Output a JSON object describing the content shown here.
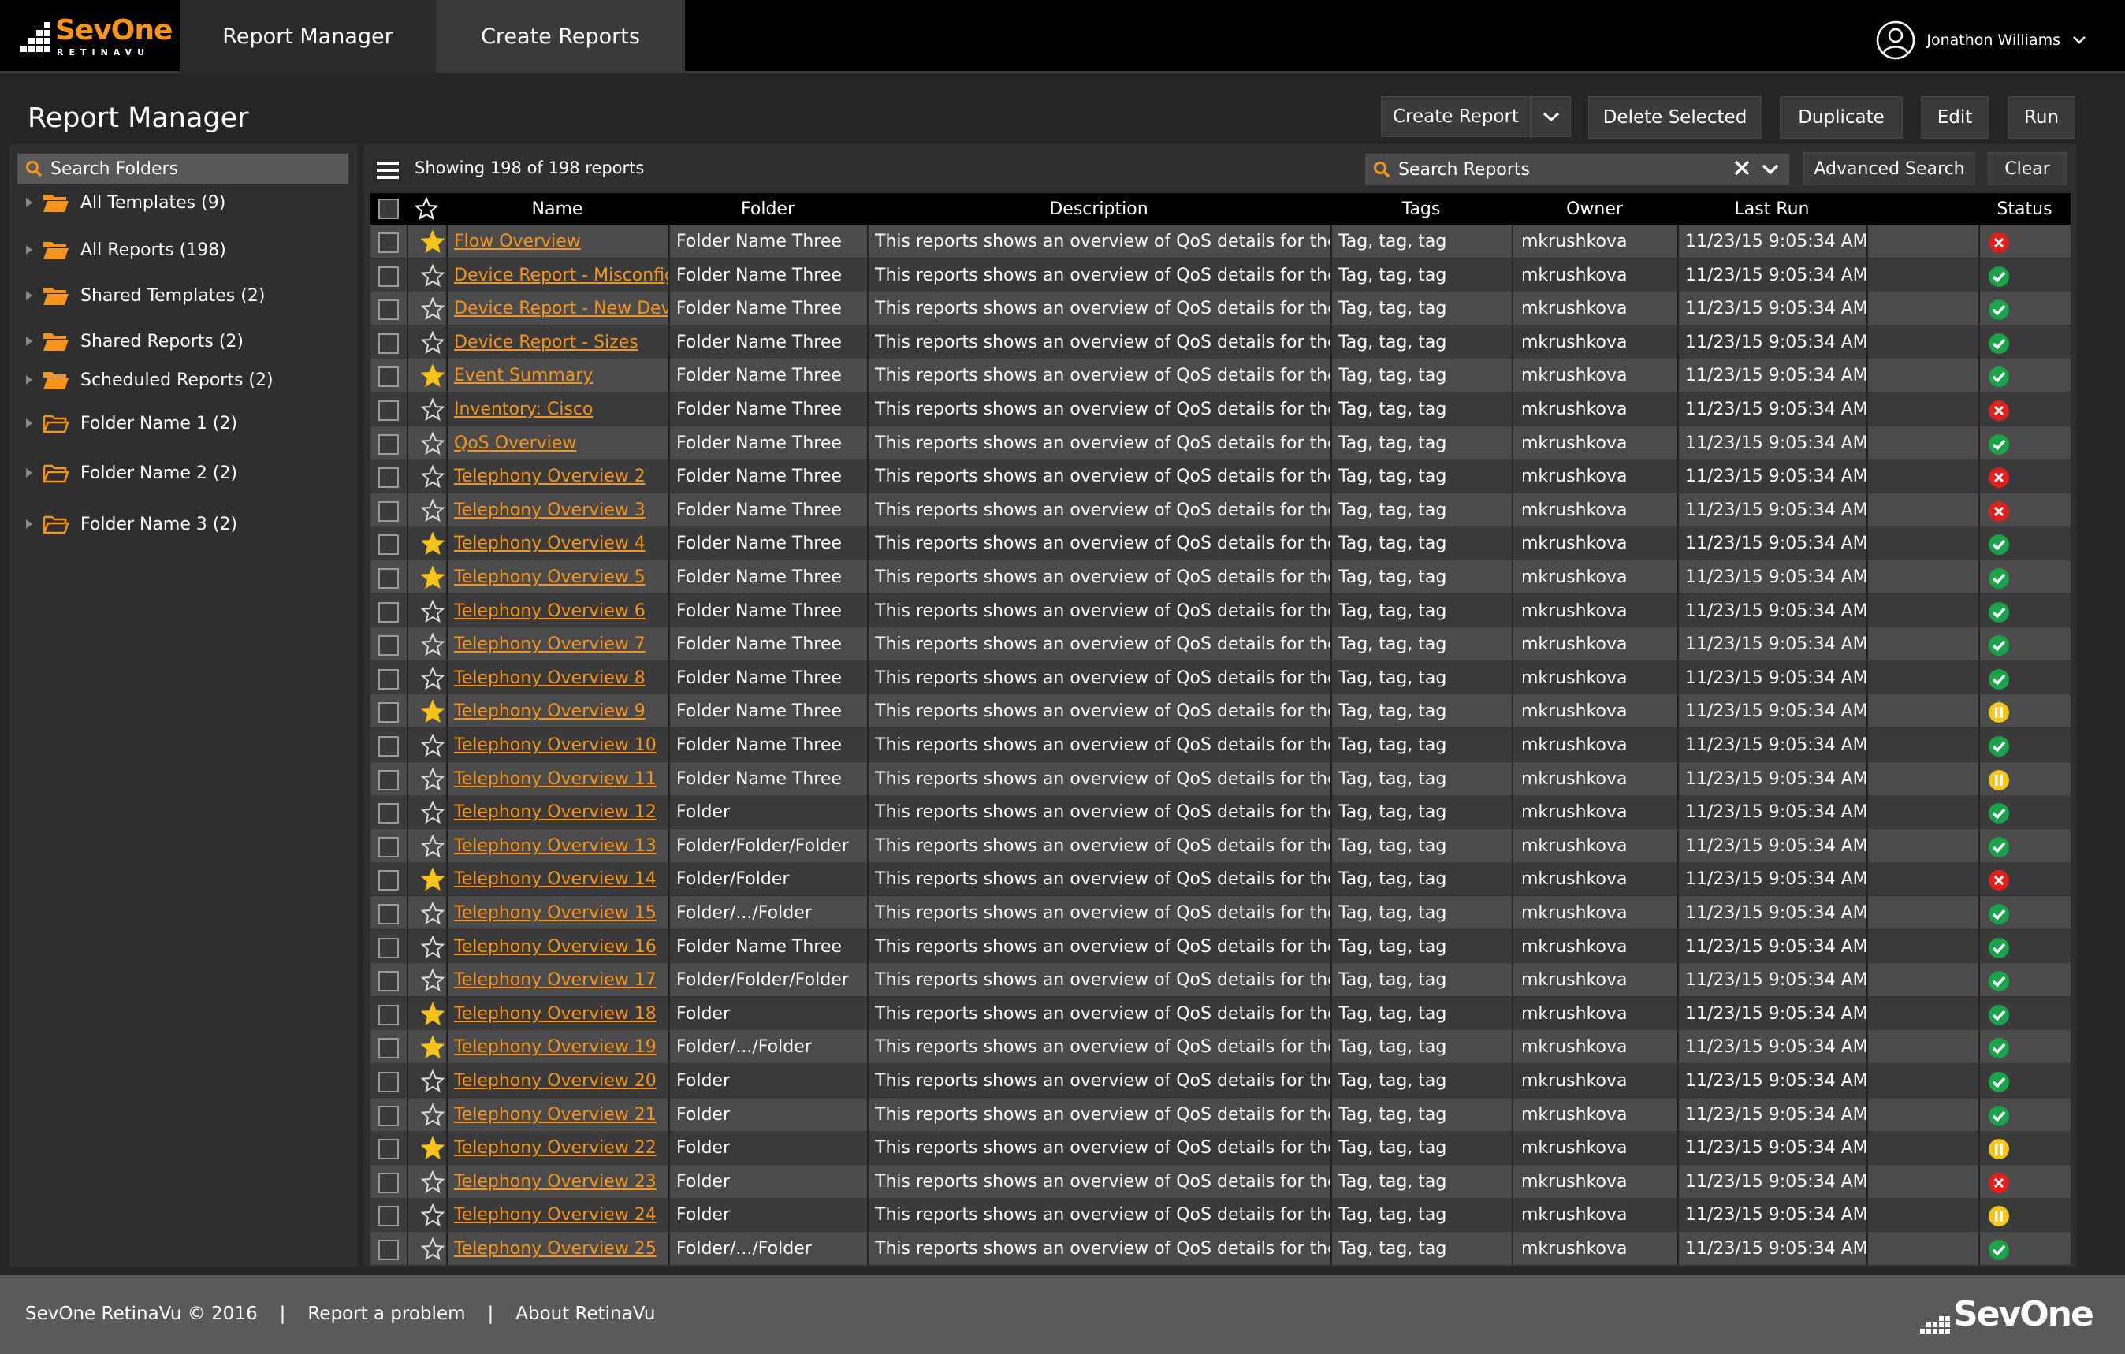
{
  "app": {
    "logo_name": "SevOne",
    "logo_sub": "RETINAVU"
  },
  "nav": {
    "tabs": [
      {
        "label": "Report Manager"
      },
      {
        "label": "Create Reports"
      }
    ]
  },
  "user": {
    "name": "Jonathon Williams"
  },
  "page": {
    "title": "Report Manager"
  },
  "actions": {
    "create": "Create Report",
    "delete": "Delete Selected",
    "duplicate": "Duplicate",
    "edit": "Edit",
    "run": "Run"
  },
  "sidebar": {
    "search_placeholder": "Search Folders",
    "items": [
      {
        "label": "All Templates (9)",
        "type": "filled"
      },
      {
        "label": "All Reports (198)",
        "type": "filled"
      },
      {
        "label": "Shared Templates (2)",
        "type": "filled"
      },
      {
        "label": "Shared Reports (2)",
        "type": "filled"
      },
      {
        "label": "Scheduled Reports (2)",
        "type": "filled"
      },
      {
        "label": "Folder Name 1 (2)",
        "type": "outline"
      },
      {
        "label": "Folder Name 2 (2)",
        "type": "outline"
      },
      {
        "label": "Folder Name 3 (2)",
        "type": "outline"
      }
    ]
  },
  "toolbar": {
    "count": "Showing 198 of 198 reports",
    "search_placeholder": "Search Reports",
    "advanced": "Advanced Search",
    "clear": "Clear"
  },
  "table": {
    "columns": [
      "Name",
      "Folder",
      "Description",
      "Tags",
      "Owner",
      "Last Run",
      "Status"
    ],
    "rows": [
      {
        "name": "Flow Overview",
        "folder": "Folder Name Three",
        "desc": "This reports shows an overview of QoS details for the...",
        "tags": "Tag, tag, tag",
        "owner": "mkrushkova",
        "last_run": "11/23/15 9:05:34 AM",
        "status": "error",
        "starred": true
      },
      {
        "name": "Device Report - Misconfiguration",
        "folder": "Folder Name Three",
        "desc": "This reports shows an overview of QoS details for the...",
        "tags": "Tag, tag, tag",
        "owner": "mkrushkova",
        "last_run": "11/23/15 9:05:34 AM",
        "status": "ok",
        "starred": false
      },
      {
        "name": "Device Report - New Devices",
        "folder": "Folder Name Three",
        "desc": "This reports shows an overview of QoS details for the...",
        "tags": "Tag, tag, tag",
        "owner": "mkrushkova",
        "last_run": "11/23/15 9:05:34 AM",
        "status": "ok",
        "starred": false
      },
      {
        "name": "Device Report - Sizes",
        "folder": "Folder Name Three",
        "desc": "This reports shows an overview of QoS details for the...",
        "tags": "Tag, tag, tag",
        "owner": "mkrushkova",
        "last_run": "11/23/15 9:05:34 AM",
        "status": "ok",
        "starred": false
      },
      {
        "name": "Event Summary",
        "folder": "Folder Name Three",
        "desc": "This reports shows an overview of QoS details for the...",
        "tags": "Tag, tag, tag",
        "owner": "mkrushkova",
        "last_run": "11/23/15 9:05:34 AM",
        "status": "ok",
        "starred": true
      },
      {
        "name": "Inventory: Cisco",
        "folder": "Folder Name Three",
        "desc": "This reports shows an overview of QoS details for the...",
        "tags": "Tag, tag, tag",
        "owner": "mkrushkova",
        "last_run": "11/23/15 9:05:34 AM",
        "status": "error",
        "starred": false
      },
      {
        "name": "QoS Overview",
        "folder": "Folder Name Three",
        "desc": "This reports shows an overview of QoS details for the...",
        "tags": "Tag, tag, tag",
        "owner": "mkrushkova",
        "last_run": "11/23/15 9:05:34 AM",
        "status": "ok",
        "starred": false
      },
      {
        "name": "Telephony Overview 2",
        "folder": "Folder Name Three",
        "desc": "This reports shows an overview of QoS details for the...",
        "tags": "Tag, tag, tag",
        "owner": "mkrushkova",
        "last_run": "11/23/15 9:05:34 AM",
        "status": "error",
        "starred": false
      },
      {
        "name": "Telephony Overview 3",
        "folder": "Folder Name Three",
        "desc": "This reports shows an overview of QoS details for the...",
        "tags": "Tag, tag, tag",
        "owner": "mkrushkova",
        "last_run": "11/23/15 9:05:34 AM",
        "status": "error",
        "starred": false
      },
      {
        "name": "Telephony Overview 4",
        "folder": "Folder Name Three",
        "desc": "This reports shows an overview of QoS details for the...",
        "tags": "Tag, tag, tag",
        "owner": "mkrushkova",
        "last_run": "11/23/15 9:05:34 AM",
        "status": "ok",
        "starred": true
      },
      {
        "name": "Telephony Overview 5",
        "folder": "Folder Name Three",
        "desc": "This reports shows an overview of QoS details for the...",
        "tags": "Tag, tag, tag",
        "owner": "mkrushkova",
        "last_run": "11/23/15 9:05:34 AM",
        "status": "ok",
        "starred": true
      },
      {
        "name": "Telephony Overview 6",
        "folder": "Folder Name Three",
        "desc": "This reports shows an overview of QoS details for the...",
        "tags": "Tag, tag, tag",
        "owner": "mkrushkova",
        "last_run": "11/23/15 9:05:34 AM",
        "status": "ok",
        "starred": false
      },
      {
        "name": "Telephony Overview 7",
        "folder": "Folder Name Three",
        "desc": "This reports shows an overview of QoS details for the...",
        "tags": "Tag, tag, tag",
        "owner": "mkrushkova",
        "last_run": "11/23/15 9:05:34 AM",
        "status": "ok",
        "starred": false
      },
      {
        "name": "Telephony Overview 8",
        "folder": "Folder Name Three",
        "desc": "This reports shows an overview of QoS details for the...",
        "tags": "Tag, tag, tag",
        "owner": "mkrushkova",
        "last_run": "11/23/15 9:05:34 AM",
        "status": "ok",
        "starred": false
      },
      {
        "name": "Telephony Overview 9",
        "folder": "Folder Name Three",
        "desc": "This reports shows an overview of QoS details for the...",
        "tags": "Tag, tag, tag",
        "owner": "mkrushkova",
        "last_run": "11/23/15 9:05:34 AM",
        "status": "pause",
        "starred": true
      },
      {
        "name": "Telephony Overview 10",
        "folder": "Folder Name Three",
        "desc": "This reports shows an overview of QoS details for the...",
        "tags": "Tag, tag, tag",
        "owner": "mkrushkova",
        "last_run": "11/23/15 9:05:34 AM",
        "status": "ok",
        "starred": false
      },
      {
        "name": "Telephony Overview 11",
        "folder": "Folder Name Three",
        "desc": "This reports shows an overview of QoS details for the...",
        "tags": "Tag, tag, tag",
        "owner": "mkrushkova",
        "last_run": "11/23/15 9:05:34 AM",
        "status": "pause",
        "starred": false
      },
      {
        "name": "Telephony Overview 12",
        "folder": "Folder",
        "desc": "This reports shows an overview of QoS details for the...",
        "tags": "Tag, tag, tag",
        "owner": "mkrushkova",
        "last_run": "11/23/15 9:05:34 AM",
        "status": "ok",
        "starred": false
      },
      {
        "name": "Telephony Overview 13",
        "folder": "Folder/Folder/Folder",
        "desc": "This reports shows an overview of QoS details for the...",
        "tags": "Tag, tag, tag",
        "owner": "mkrushkova",
        "last_run": "11/23/15 9:05:34 AM",
        "status": "ok",
        "starred": false
      },
      {
        "name": "Telephony Overview 14",
        "folder": "Folder/Folder",
        "desc": "This reports shows an overview of QoS details for the...",
        "tags": "Tag, tag, tag",
        "owner": "mkrushkova",
        "last_run": "11/23/15 9:05:34 AM",
        "status": "error",
        "starred": true
      },
      {
        "name": "Telephony Overview 15",
        "folder": "Folder/.../Folder",
        "desc": "This reports shows an overview of QoS details for the...",
        "tags": "Tag, tag, tag",
        "owner": "mkrushkova",
        "last_run": "11/23/15 9:05:34 AM",
        "status": "ok",
        "starred": false
      },
      {
        "name": "Telephony Overview 16",
        "folder": "Folder Name Three",
        "desc": "This reports shows an overview of QoS details for the...",
        "tags": "Tag, tag, tag",
        "owner": "mkrushkova",
        "last_run": "11/23/15 9:05:34 AM",
        "status": "ok",
        "starred": false
      },
      {
        "name": "Telephony Overview 17",
        "folder": "Folder/Folder/Folder",
        "desc": "This reports shows an overview of QoS details for the...",
        "tags": "Tag, tag, tag",
        "owner": "mkrushkova",
        "last_run": "11/23/15 9:05:34 AM",
        "status": "ok",
        "starred": false
      },
      {
        "name": "Telephony Overview 18",
        "folder": "Folder",
        "desc": "This reports shows an overview of QoS details for the...",
        "tags": "Tag, tag, tag",
        "owner": "mkrushkova",
        "last_run": "11/23/15 9:05:34 AM",
        "status": "ok",
        "starred": true
      },
      {
        "name": "Telephony Overview 19",
        "folder": "Folder/.../Folder",
        "desc": "This reports shows an overview of QoS details for the...",
        "tags": "Tag, tag, tag",
        "owner": "mkrushkova",
        "last_run": "11/23/15 9:05:34 AM",
        "status": "ok",
        "starred": true
      },
      {
        "name": "Telephony Overview 20",
        "folder": "Folder",
        "desc": "This reports shows an overview of QoS details for the...",
        "tags": "Tag, tag, tag",
        "owner": "mkrushkova",
        "last_run": "11/23/15 9:05:34 AM",
        "status": "ok",
        "starred": false
      },
      {
        "name": "Telephony Overview 21",
        "folder": "Folder",
        "desc": "This reports shows an overview of QoS details for the...",
        "tags": "Tag, tag, tag",
        "owner": "mkrushkova",
        "last_run": "11/23/15 9:05:34 AM",
        "status": "ok",
        "starred": false
      },
      {
        "name": "Telephony Overview 22",
        "folder": "Folder",
        "desc": "This reports shows an overview of QoS details for the...",
        "tags": "Tag, tag, tag",
        "owner": "mkrushkova",
        "last_run": "11/23/15 9:05:34 AM",
        "status": "pause",
        "starred": true
      },
      {
        "name": "Telephony Overview 23",
        "folder": "Folder",
        "desc": "This reports shows an overview of QoS details for the...",
        "tags": "Tag, tag, tag",
        "owner": "mkrushkova",
        "last_run": "11/23/15 9:05:34 AM",
        "status": "error",
        "starred": false
      },
      {
        "name": "Telephony Overview 24",
        "folder": "Folder",
        "desc": "This reports shows an overview of QoS details for the...",
        "tags": "Tag, tag, tag",
        "owner": "mkrushkova",
        "last_run": "11/23/15 9:05:34 AM",
        "status": "pause",
        "starred": false
      },
      {
        "name": "Telephony Overview 25",
        "folder": "Folder/.../Folder",
        "desc": "This reports shows an overview of QoS details for the...",
        "tags": "Tag, tag, tag",
        "owner": "mkrushkova",
        "last_run": "11/23/15 9:05:34 AM",
        "status": "ok",
        "starred": false
      }
    ]
  },
  "footer": {
    "copyright": "SevOne RetinaVu © 2016",
    "sep": "|",
    "report": "Report a problem",
    "about": "About RetinaVu",
    "logo": "SevOne"
  },
  "colors": {
    "accent": "#f7941d",
    "ok": "#1aa34a",
    "error": "#e02020",
    "pause": "#f5c518",
    "star": "#f7c21a"
  }
}
